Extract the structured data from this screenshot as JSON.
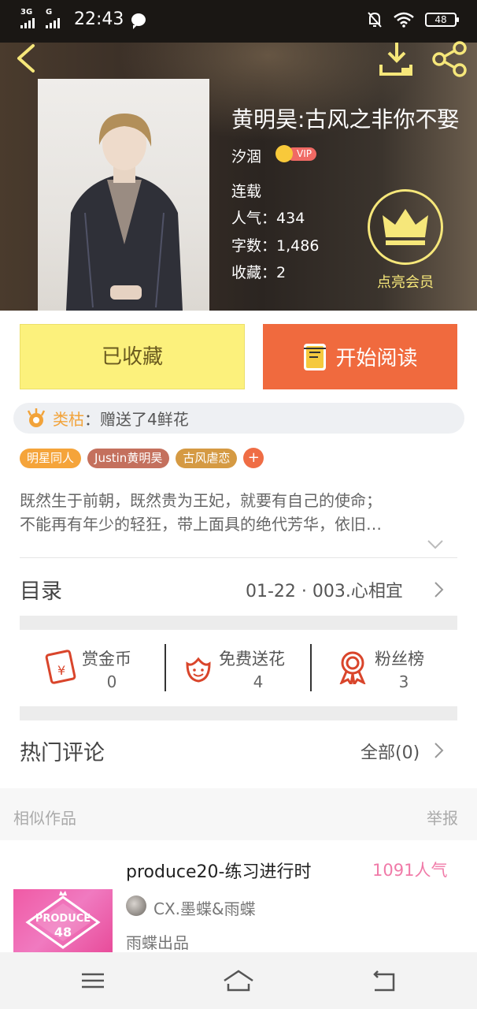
{
  "status_bar": {
    "network_1": "3G",
    "network_2": "G",
    "time": "22:43",
    "battery": "48"
  },
  "header": {
    "icons": [
      "back-icon",
      "download-icon",
      "share-icon"
    ]
  },
  "book": {
    "title": "黄明昊:古风之非你不娶",
    "author": "汐涸",
    "vip_label": "VIP",
    "status": "连载",
    "popularity_label": "人气：",
    "popularity": "434",
    "words_label": "字数：",
    "words": "1,486",
    "favorites_label": "收藏：",
    "favorites": "2"
  },
  "member": {
    "label": "点亮会员",
    "accent": "#f6e77a"
  },
  "actions": {
    "collected_label": "已收藏",
    "read_label": "开始阅读"
  },
  "gift": {
    "user": "类枯",
    "text": "：赠送了4鲜花"
  },
  "tags": [
    {
      "label": "明星同人",
      "color": "#f5a43a"
    },
    {
      "label": "Justin黄明昊",
      "color": "#c4705d"
    },
    {
      "label": "古风虐恋",
      "color": "#d59a43"
    }
  ],
  "tag_add": "+",
  "description": {
    "line1": "既然生于前朝，既然贵为王妃，就要有自己的使命；",
    "line2": "不能再有年少的轻狂，带上面具的绝代芳华，依旧…"
  },
  "catalog": {
    "title": "目录",
    "latest": "01-22 · 003.心相宜"
  },
  "stats": [
    {
      "label": "赏金币",
      "value": "0"
    },
    {
      "label": "免费送花",
      "value": "4"
    },
    {
      "label": "粉丝榜",
      "value": "3"
    }
  ],
  "comments": {
    "title": "热门评论",
    "all_label": "全部(0)"
  },
  "similar": {
    "title": "相似作品",
    "report": "举报",
    "items": [
      {
        "title": "produce20-练习进行时",
        "popularity": "1091人气",
        "author": "CX.墨蝶&雨蝶",
        "subtitle": "雨蝶出品",
        "cover_text_1": "PRODUCE",
        "cover_text_2": "48"
      }
    ]
  },
  "colors": {
    "read_button": "#f06a3e",
    "collected_button": "#fcf17c",
    "gift_user": "#f2a33a",
    "popularity_pink": "#f07aa8"
  }
}
